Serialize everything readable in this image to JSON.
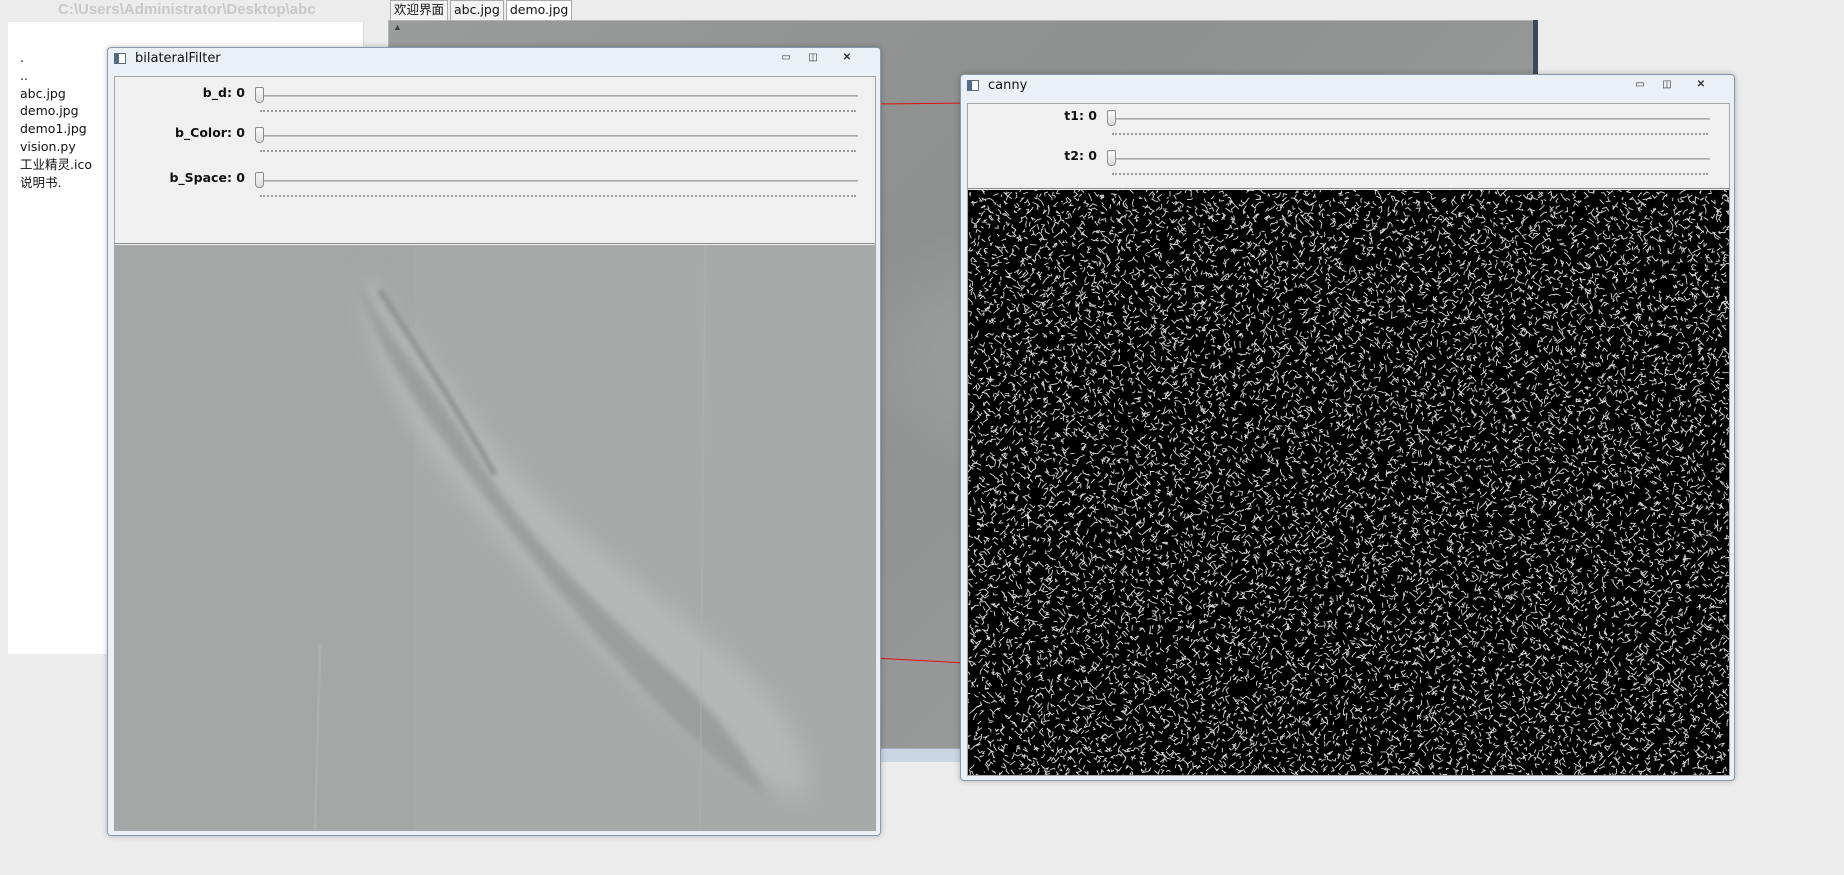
{
  "explorer": {
    "path": "C:\\Users\\Administrator\\Desktop\\abc",
    "files": [
      ".",
      "..",
      "abc.jpg",
      "demo.jpg",
      "demo1.jpg",
      "vision.py",
      "工业精灵.ico",
      "说明书."
    ]
  },
  "tabs": [
    {
      "label": "欢迎界面",
      "active": false
    },
    {
      "label": "abc.jpg",
      "active": false
    },
    {
      "label": "demo.jpg",
      "active": true
    }
  ],
  "windows": {
    "bilateral": {
      "title": "bilateralFilter",
      "trackbars": [
        {
          "label": "b_d: 0",
          "value": 0
        },
        {
          "label": "b_Color: 0",
          "value": 0
        },
        {
          "label": "b_Space: 0",
          "value": 0
        }
      ]
    },
    "canny": {
      "title": "canny",
      "trackbars": [
        {
          "label": "t1: 0",
          "value": 0
        },
        {
          "label": "t2: 0",
          "value": 0
        }
      ]
    }
  },
  "window_buttons": {
    "minimize": "▭",
    "maximize": "◫",
    "close": "✕"
  },
  "colors": {
    "edge_lines": "#ffffff",
    "canny_bg": "#000000",
    "annotation_line": "#e01010"
  }
}
